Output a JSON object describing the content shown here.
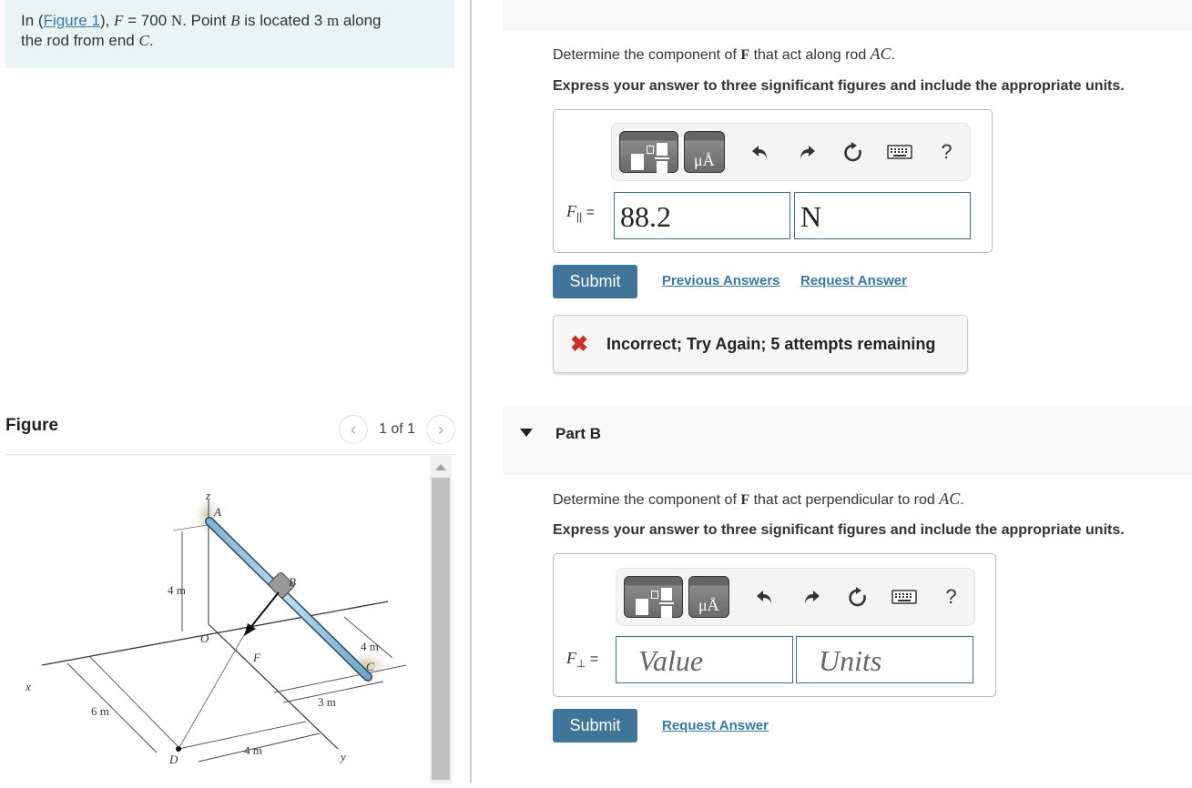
{
  "intro": {
    "prefix": "In (",
    "figure_link": "Figure 1",
    "after_link": "), ",
    "f_symbol": "F",
    "f_eq": " = 700 ",
    "f_unit": "N",
    "mid": ". Point ",
    "b_symbol": "B",
    "located": " is located 3 ",
    "m_unit": "m",
    "along": " along",
    "line2": "the rod from end ",
    "c_symbol": "C",
    "end": "."
  },
  "figure_panel": {
    "title": "Figure",
    "pager_text": "1 of 1",
    "prev_icon": "chevron-left-icon",
    "next_icon": "chevron-right-icon",
    "labels": {
      "z": "z",
      "A": "A",
      "B": "B",
      "C": "C",
      "D": "D",
      "O": "O",
      "F": "F",
      "x": "x",
      "y": "y",
      "dim_4m_vertical": "4 m",
      "dim_4m_right": "4 m",
      "dim_3m": "3 m",
      "dim_6m": "6 m",
      "dim_4m_bottom": "4 m"
    }
  },
  "part_a": {
    "question_prefix": "Determine the component of ",
    "question_vec": "F",
    "question_mid": " that act along rod ",
    "question_rod": "AC",
    "question_end": ".",
    "instruction": "Express your answer to three significant figures and include the appropriate units.",
    "label_symbol": "F",
    "label_sub": "||",
    "label_eq": " =",
    "value": "88.2",
    "units": "N",
    "submit": "Submit",
    "previous_answers": "Previous Answers",
    "request_answer": "Request Answer",
    "feedback": "Incorrect; Try Again; 5 attempts remaining",
    "feedback_icon": "x-mark-icon"
  },
  "part_b": {
    "title": "Part B",
    "question_prefix": "Determine the component of ",
    "question_vec": "F",
    "question_mid": " that act perpendicular to rod ",
    "question_rod": "AC",
    "question_end": ".",
    "instruction": "Express your answer to three significant figures and include the appropriate units.",
    "label_symbol": "F",
    "label_sub": "⊥",
    "label_eq": " =",
    "value_placeholder": "Value",
    "units_placeholder": "Units",
    "submit": "Submit",
    "request_answer": "Request Answer"
  },
  "toolbar": {
    "templates_icon": "templates-icon",
    "units_label": "μÅ",
    "undo_icon": "undo-icon",
    "redo_icon": "redo-icon",
    "reset_icon": "reset-icon",
    "keyboard_icon": "keyboard-icon",
    "help_label": "?"
  },
  "colors": {
    "submit_bg": "#3f7598",
    "link": "#3a77a3",
    "intro_bg": "#e9f4f5",
    "error": "#c9302c",
    "input_border": "#3c6e8e"
  }
}
